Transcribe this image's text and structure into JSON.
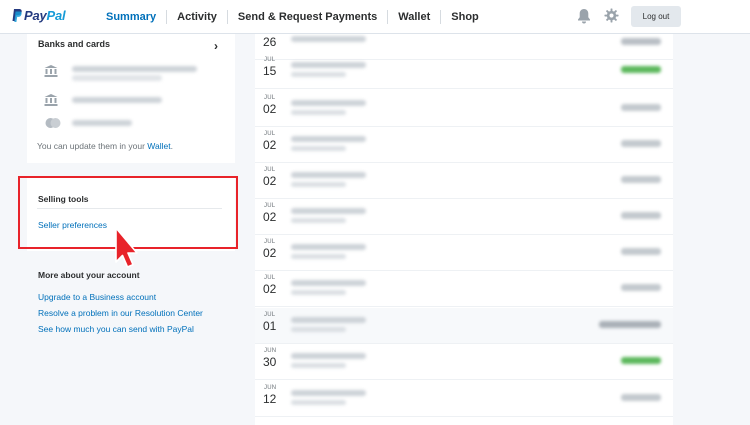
{
  "header": {
    "logo_pay": "Pay",
    "logo_pal": "Pal",
    "nav": [
      "Summary",
      "Activity",
      "Send & Request Payments",
      "Wallet",
      "Shop"
    ],
    "logout": "Log out"
  },
  "banks_card": {
    "title": "Banks and cards",
    "update_prefix": "You can update them in your ",
    "update_link": "Wallet",
    "update_suffix": "."
  },
  "selling_tools": {
    "title": "Selling tools",
    "link": "Seller preferences"
  },
  "more_account": {
    "title": "More about your account",
    "links": [
      "Upgrade to a Business account",
      "Resolve a problem in our Resolution Center",
      "See how much you can send with PayPal"
    ]
  },
  "activity": [
    {
      "month": "",
      "day": "26"
    },
    {
      "month": "JUL",
      "day": "15"
    },
    {
      "month": "JUL",
      "day": "02"
    },
    {
      "month": "JUL",
      "day": "02"
    },
    {
      "month": "JUL",
      "day": "02"
    },
    {
      "month": "JUL",
      "day": "02"
    },
    {
      "month": "JUL",
      "day": "02"
    },
    {
      "month": "JUL",
      "day": "02"
    },
    {
      "month": "JUL",
      "day": "01"
    },
    {
      "month": "JUN",
      "day": "30"
    },
    {
      "month": "JUN",
      "day": "12"
    }
  ],
  "colors": {
    "brand_dark": "#253b80",
    "brand_light": "#179bd7",
    "link": "#0070ba",
    "highlight": "#e8232a",
    "positive_amount": "#5cb85c"
  }
}
